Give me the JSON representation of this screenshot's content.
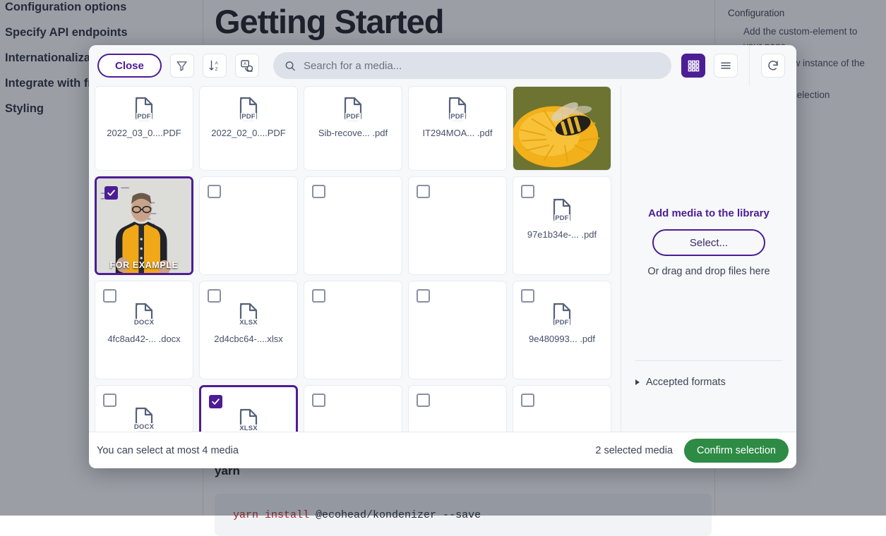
{
  "background": {
    "sidebar_items": [
      "Configuration options",
      "Specify API endpoints",
      "Internationalization",
      "Integrate with frameworks",
      "Styling"
    ],
    "page_title": "Getting Started",
    "yarn_heading": "yarn",
    "code_keyword": "yarn install",
    "code_rest": " @ecohead/kondenizer --save",
    "toc": [
      {
        "label": "Configuration",
        "level": 1
      },
      {
        "label": "Add the custom-element to your page",
        "level": 2
      },
      {
        "label": "Create a new instance of the component",
        "level": 2
      },
      {
        "label": "Handle the selection confirmation",
        "level": 2
      }
    ]
  },
  "modal": {
    "toolbar": {
      "close_label": "Close",
      "filter_icon": "filter-icon",
      "sort_icon": "sort-az-icon",
      "translate_icon": "translate-icon",
      "search_placeholder": "Search for a media...",
      "search_value": "",
      "search_icon": "search-icon",
      "grid_view_icon": "grid-view-icon",
      "list_view_icon": "list-view-icon",
      "refresh_icon": "refresh-icon"
    },
    "grid": {
      "rows": [
        {
          "partial_top": true,
          "cards": [
            {
              "type": "file",
              "ext": "PDF",
              "name": "2022_03_0....PDF",
              "selected": false,
              "checkbox": false
            },
            {
              "type": "file",
              "ext": "PDF",
              "name": "2022_02_0....PDF",
              "selected": false,
              "checkbox": false
            },
            {
              "type": "file",
              "ext": "PDF",
              "name": "Sib-recove... .pdf",
              "selected": false,
              "checkbox": false
            },
            {
              "type": "file",
              "ext": "PDF",
              "name": "IT294MOA... .pdf",
              "selected": false,
              "checkbox": false
            },
            {
              "type": "image",
              "name": "",
              "selected": false,
              "checkbox": false,
              "caption": "",
              "image": "bee-on-yellow-flower"
            }
          ]
        },
        {
          "cards": [
            {
              "type": "image",
              "name": "",
              "selected": true,
              "checkbox": true,
              "caption": "FOR EXAMPLE",
              "image": "man-in-yellow-vest-whiteboard"
            },
            {
              "type": "empty",
              "name": "",
              "selected": false,
              "checkbox": true
            },
            {
              "type": "empty",
              "name": "",
              "selected": false,
              "checkbox": true
            },
            {
              "type": "empty",
              "name": "",
              "selected": false,
              "checkbox": true
            },
            {
              "type": "file",
              "ext": "PDF",
              "name": "97e1b34e-... .pdf",
              "selected": false,
              "checkbox": true
            }
          ]
        },
        {
          "cards": [
            {
              "type": "file",
              "ext": "DOCX",
              "name": "4fc8ad42-... .docx",
              "selected": false,
              "checkbox": true
            },
            {
              "type": "file",
              "ext": "XLSX",
              "name": "2d4cbc64-....xlsx",
              "selected": false,
              "checkbox": true
            },
            {
              "type": "empty",
              "name": "",
              "selected": false,
              "checkbox": true
            },
            {
              "type": "empty",
              "name": "",
              "selected": false,
              "checkbox": true
            },
            {
              "type": "file",
              "ext": "PDF",
              "name": "9e480993... .pdf",
              "selected": false,
              "checkbox": true
            }
          ]
        },
        {
          "partial_bottom": true,
          "cards": [
            {
              "type": "file",
              "ext": "DOCX",
              "name": "",
              "selected": false,
              "checkbox": true
            },
            {
              "type": "file",
              "ext": "XLSX",
              "name": "",
              "selected": true,
              "checkbox": true
            },
            {
              "type": "empty",
              "name": "",
              "selected": false,
              "checkbox": true
            },
            {
              "type": "empty",
              "name": "",
              "selected": false,
              "checkbox": true
            },
            {
              "type": "empty",
              "name": "",
              "selected": false,
              "checkbox": true
            }
          ]
        }
      ]
    },
    "side_panel": {
      "title": "Add media to the library",
      "select_label": "Select...",
      "drag_text": "Or drag and drop files here",
      "accepted_formats_label": "Accepted formats",
      "accepted_expanded": false
    },
    "footer": {
      "note": "You can select at most 4 media",
      "selected_count": "2 selected media",
      "confirm_label": "Confirm selection"
    }
  },
  "colors": {
    "accent_purple": "#4c1d95",
    "confirm_green": "#2e8b45",
    "modal_bg": "#f7f8fa",
    "card_border": "#e8ebf0",
    "text_muted": "#3b4455"
  }
}
